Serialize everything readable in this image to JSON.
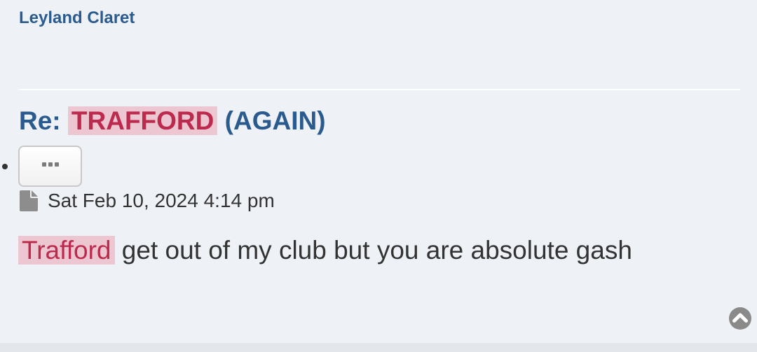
{
  "post": {
    "author": "Leyland Claret",
    "title_prefix": "Re: ",
    "title_highlight": "TRAFFORD",
    "title_suffix": " (AGAIN)",
    "date": "Sat Feb 10, 2024 4:14 pm",
    "content_highlight": "Trafford",
    "content_rest": " get out of my club but you are absolute gash"
  },
  "icons": {
    "more": "ellipsis-icon",
    "post": "file-icon",
    "top": "chevron-up-circle-icon"
  },
  "colors": {
    "background": "#eef2f7",
    "link": "#2a5a8e",
    "highlight_bg": "#ecc6d0",
    "highlight_text": "#bc2a4d",
    "text": "#333333"
  }
}
